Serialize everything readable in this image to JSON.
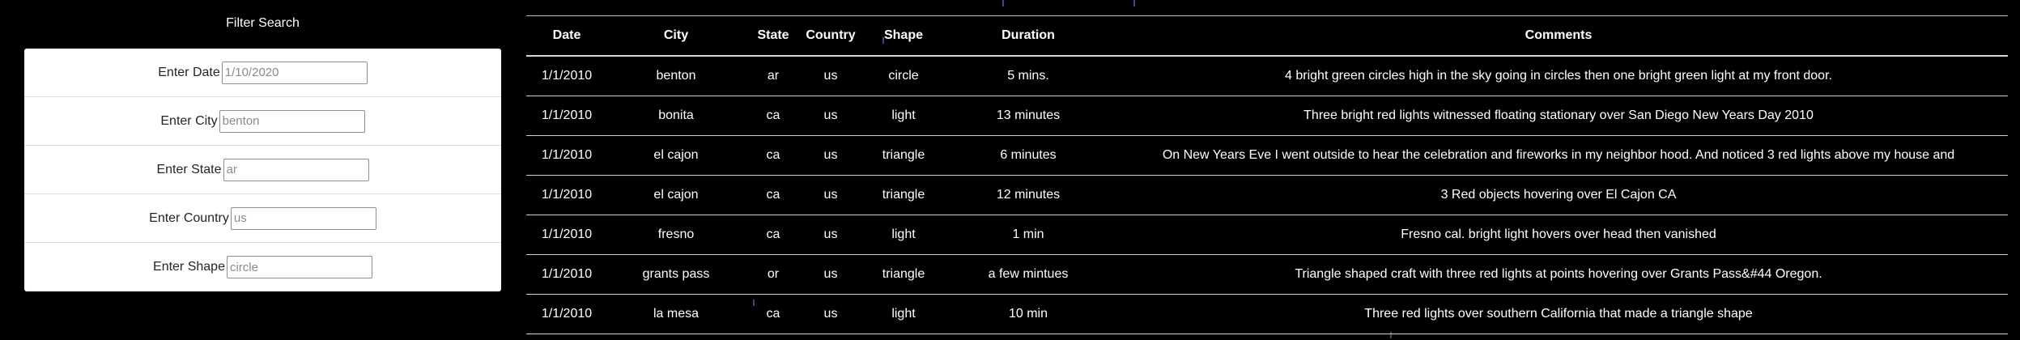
{
  "filter": {
    "title": "Filter Search",
    "fields": [
      {
        "label": "Enter Date",
        "placeholder": "1/10/2020"
      },
      {
        "label": "Enter City",
        "placeholder": "benton"
      },
      {
        "label": "Enter State",
        "placeholder": "ar"
      },
      {
        "label": "Enter Country",
        "placeholder": "us"
      },
      {
        "label": "Enter Shape",
        "placeholder": "circle"
      }
    ]
  },
  "table": {
    "headers": [
      "Date",
      "City",
      "State",
      "Country",
      "Shape",
      "Duration",
      "Comments"
    ],
    "rows": [
      {
        "date": "1/1/2010",
        "city": "benton",
        "state": "ar",
        "country": "us",
        "shape": "circle",
        "duration": "5 mins.",
        "comments": "4 bright green circles high in the sky going in circles then one bright green light at my front door."
      },
      {
        "date": "1/1/2010",
        "city": "bonita",
        "state": "ca",
        "country": "us",
        "shape": "light",
        "duration": "13 minutes",
        "comments": "Three bright red lights witnessed floating stationary over San Diego New Years Day 2010"
      },
      {
        "date": "1/1/2010",
        "city": "el cajon",
        "state": "ca",
        "country": "us",
        "shape": "triangle",
        "duration": "6 minutes",
        "comments": "On New Years Eve I went outside to hear the celebration and fireworks in my neighbor hood. And noticed 3 red lights above my house and"
      },
      {
        "date": "1/1/2010",
        "city": "el cajon",
        "state": "ca",
        "country": "us",
        "shape": "triangle",
        "duration": "12 minutes",
        "comments": "3 Red objects hovering over El Cajon CA"
      },
      {
        "date": "1/1/2010",
        "city": "fresno",
        "state": "ca",
        "country": "us",
        "shape": "light",
        "duration": "1 min",
        "comments": "Fresno cal. bright light hovers over head then vanished"
      },
      {
        "date": "1/1/2010",
        "city": "grants pass",
        "state": "or",
        "country": "us",
        "shape": "triangle",
        "duration": "a few mintues",
        "comments": "Triangle shaped craft with three red lights at points hovering over Grants Pass&#44 Oregon."
      },
      {
        "date": "1/1/2010",
        "city": "la mesa",
        "state": "ca",
        "country": "us",
        "shape": "light",
        "duration": "10 min",
        "comments": "Three red lights over southern California that made a triangle shape"
      }
    ]
  }
}
